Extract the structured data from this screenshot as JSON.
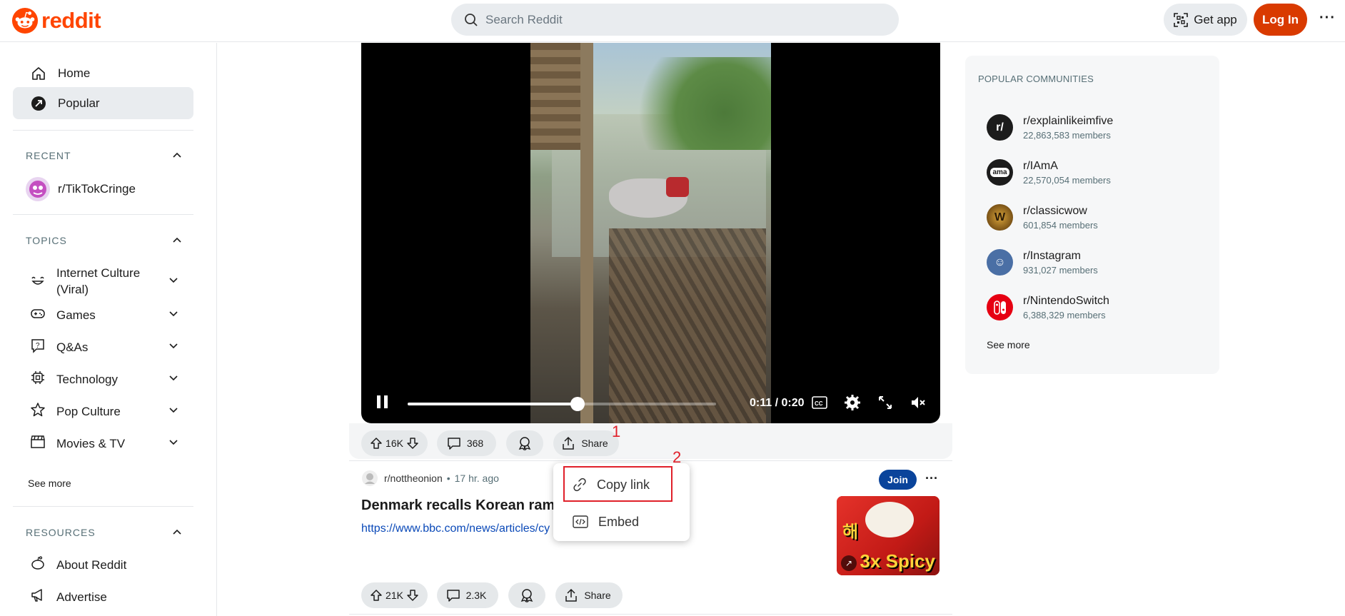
{
  "header": {
    "logo_text": "reddit",
    "search_placeholder": "Search Reddit",
    "get_app_label": "Get app",
    "login_label": "Log In",
    "more_label": "···"
  },
  "sidebar": {
    "nav": [
      {
        "label": "Home",
        "icon": "home-icon"
      },
      {
        "label": "Popular",
        "icon": "popular-icon",
        "active": true
      }
    ],
    "recent_header": "RECENT",
    "recent": [
      {
        "label": "r/TikTokCringe"
      }
    ],
    "topics_header": "TOPICS",
    "topics": [
      {
        "label": "Internet Culture (Viral)"
      },
      {
        "label": "Games"
      },
      {
        "label": "Q&As"
      },
      {
        "label": "Technology"
      },
      {
        "label": "Pop Culture"
      },
      {
        "label": "Movies & TV"
      }
    ],
    "see_more": "See more",
    "resources_header": "RESOURCES",
    "resources": [
      {
        "label": "About Reddit"
      },
      {
        "label": "Advertise"
      }
    ]
  },
  "video": {
    "time": "0:11 / 0:20",
    "progress": 0.55
  },
  "post1_actions": {
    "votes": "16K",
    "comments": "368",
    "share": "Share"
  },
  "share_menu": {
    "copy_link": "Copy link",
    "embed": "Embed"
  },
  "annotations": {
    "a1": "1",
    "a2": "2"
  },
  "post2": {
    "subreddit": "r/nottheonion",
    "age": "17 hr. ago",
    "title": "Denmark recalls Korean rame",
    "link": "https://www.bbc.com/news/articles/cy",
    "join": "Join",
    "votes": "21K",
    "comments": "2.3K",
    "share": "Share",
    "thumb_text": "3x Spicy"
  },
  "popular_communities": {
    "title": "POPULAR COMMUNITIES",
    "items": [
      {
        "name": "r/explainlikeimfive",
        "members": "22,863,583 members",
        "color": "#1c1c1c",
        "glyph": "r/"
      },
      {
        "name": "r/IAmA",
        "members": "22,570,054 members",
        "color": "#1c1c1c",
        "glyph": "ama"
      },
      {
        "name": "r/classicwow",
        "members": "601,854 members",
        "color": "#3a2a12",
        "glyph": "W"
      },
      {
        "name": "r/Instagram",
        "members": "931,027 members",
        "color": "#4a6fa5",
        "glyph": "☺"
      },
      {
        "name": "r/NintendoSwitch",
        "members": "6,388,329 members",
        "color": "#e60012",
        "glyph": "◧"
      }
    ],
    "see_more": "See more"
  }
}
